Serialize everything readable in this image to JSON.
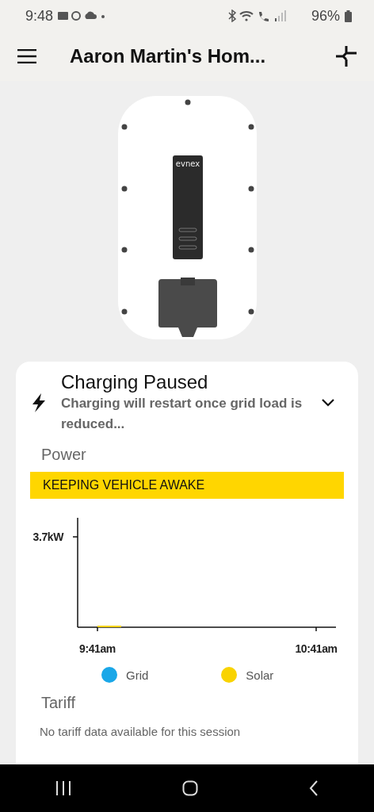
{
  "status_bar": {
    "time": "9:48",
    "battery": "96%"
  },
  "app_bar": {
    "title": "Aaron Martin's Hom..."
  },
  "charger": {
    "logo": "evnex"
  },
  "status_card": {
    "title": "Charging Paused",
    "message": "Charging will restart once grid load is reduced...",
    "expanded": false
  },
  "power": {
    "heading": "Power",
    "banner": "KEEPING VEHICLE AWAKE",
    "chart": {
      "y_label": "3.7kW",
      "x_labels": [
        "9:41am",
        "10:41am"
      ],
      "legend": [
        {
          "name": "Grid",
          "color": "#1aa7e8"
        },
        {
          "name": "Solar",
          "color": "#f9d300"
        }
      ]
    }
  },
  "tariff": {
    "heading": "Tariff",
    "message": "No tariff data available for this session"
  }
}
